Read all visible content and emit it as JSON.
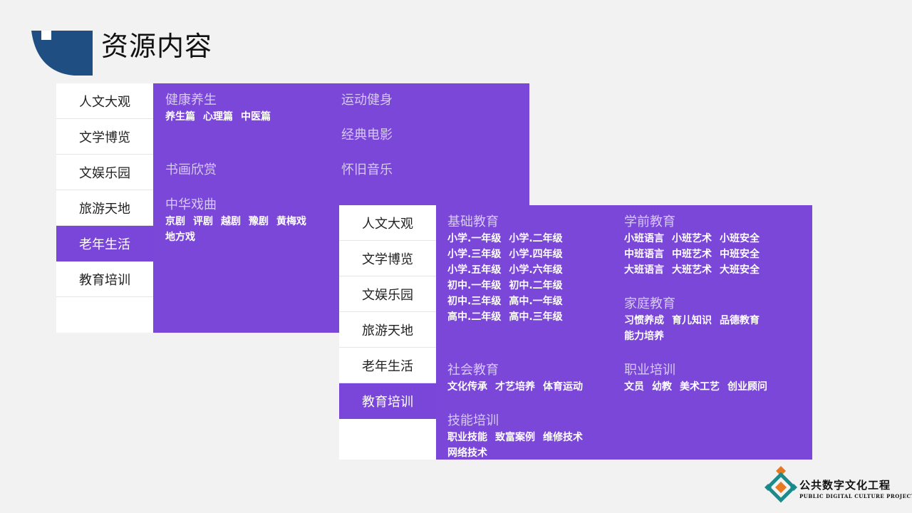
{
  "page": {
    "title": "资源内容",
    "colors": {
      "accent": "#7b47d8",
      "title_deco": "#1f4f82",
      "background": "#f2f2f2"
    }
  },
  "sidebar_items": [
    "人文大观",
    "文学博览",
    "文娱乐园",
    "旅游天地",
    "老年生活",
    "教育培训"
  ],
  "panel_left": {
    "active_item": "老年生活",
    "categories": [
      {
        "title": "健康养生",
        "rows": [
          [
            "养生篇",
            "心理篇",
            "中医篇"
          ]
        ]
      },
      {
        "title": "运动健身",
        "rows": []
      },
      {
        "title": "经典电影",
        "rows": []
      },
      {
        "title": "书画欣赏",
        "rows": []
      },
      {
        "title": "怀旧音乐",
        "rows": []
      },
      {
        "title": "中华戏曲",
        "rows": [
          [
            "京剧",
            "评剧",
            "越剧",
            "豫剧",
            "黄梅戏"
          ],
          [
            "地方戏"
          ]
        ]
      }
    ]
  },
  "panel_right": {
    "active_item": "教育培训",
    "categories": [
      {
        "title": "基础教育",
        "rows": [
          [
            "小学.一年级",
            "小学.二年级"
          ],
          [
            "小学.三年级",
            "小学.四年级"
          ],
          [
            "小学.五年级",
            "小学.六年级"
          ],
          [
            "初中.一年级",
            "初中.二年级"
          ],
          [
            "初中.三年级",
            "高中.一年级"
          ],
          [
            "高中.二年级",
            "高中.三年级"
          ]
        ]
      },
      {
        "title": "学前教育",
        "rows": [
          [
            "小班语言",
            "小班艺术",
            "小班安全"
          ],
          [
            "中班语言",
            "中班艺术",
            "中班安全"
          ],
          [
            "大班语言",
            "大班艺术",
            "大班安全"
          ]
        ]
      },
      {
        "title": "家庭教育",
        "rows": [
          [
            "习惯养成",
            "育儿知识",
            "品德教育"
          ],
          [
            "能力培养"
          ]
        ]
      },
      {
        "title": "社会教育",
        "rows": [
          [
            "文化传承",
            "才艺培养",
            "体育运动"
          ]
        ]
      },
      {
        "title": "职业培训",
        "rows": [
          [
            "文员",
            "幼教",
            "美术工艺",
            "创业顾问"
          ]
        ]
      },
      {
        "title": "技能培训",
        "rows": [
          [
            "职业技能",
            "致富案例",
            "维修技术"
          ],
          [
            "网络技术"
          ]
        ]
      }
    ]
  },
  "logo": {
    "name_cn": "公共数字文化工程",
    "name_en": "PUBLIC DIGITAL CULTURE PROJECT"
  }
}
